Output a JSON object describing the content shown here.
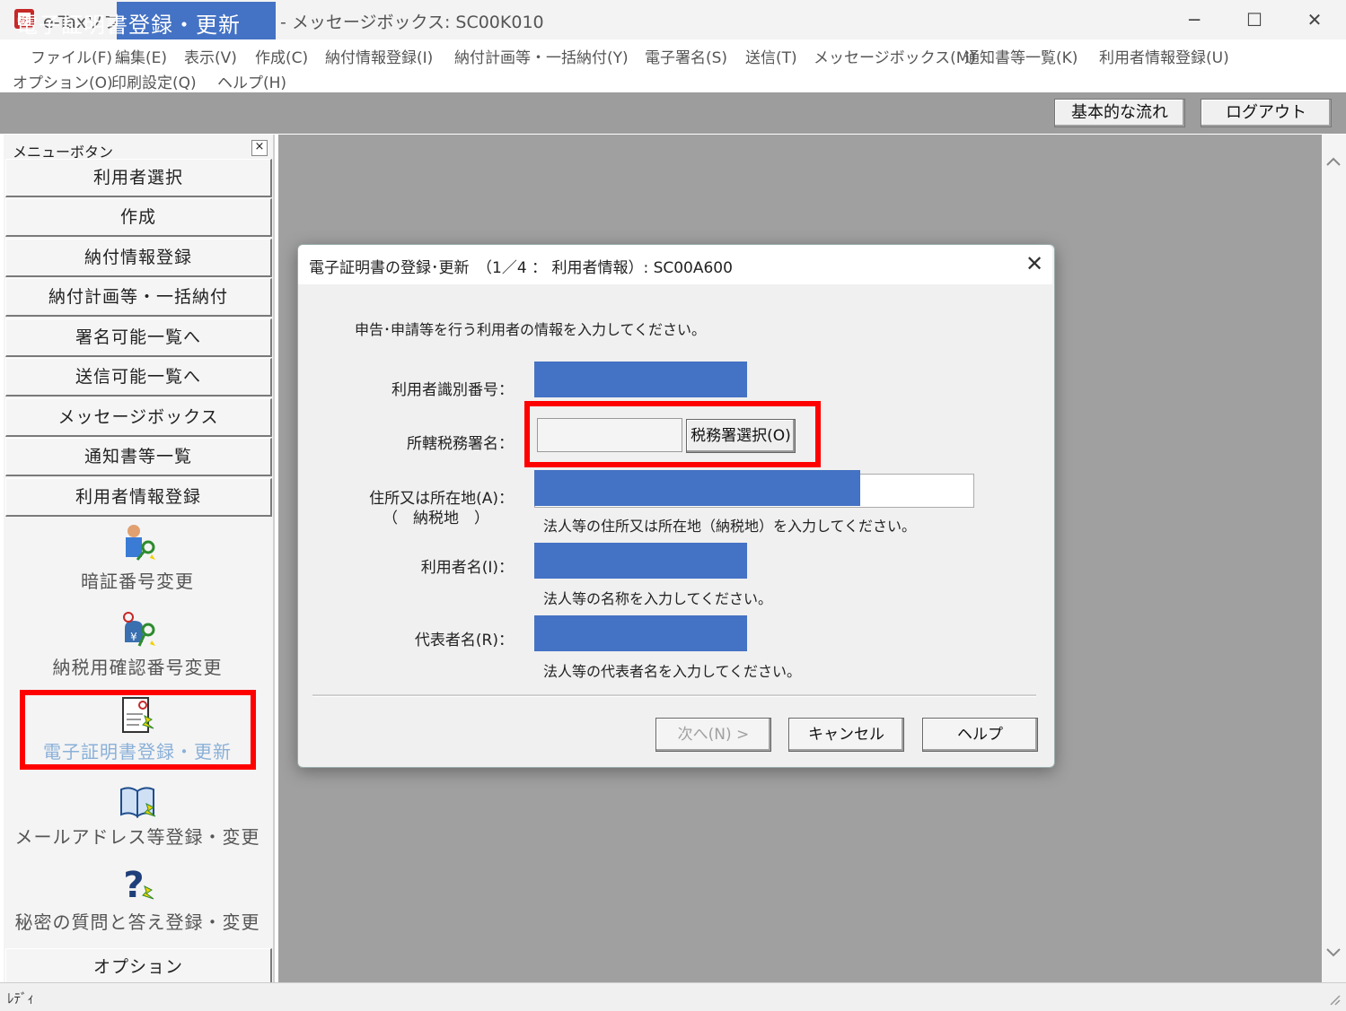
{
  "window": {
    "app_name": "e-Taxソフト",
    "title": "- メッセージボックス: SC00K010",
    "minimize": "─",
    "maximize": "☐",
    "close": "✕"
  },
  "menu": {
    "row1": [
      "ファイル(F)",
      "編集(E)",
      "表示(V)",
      "作成(C)",
      "納付情報登録(I)",
      "納付計画等・一括納付(Y)",
      "電子署名(S)",
      "送信(T)",
      "メッセージボックス(M)",
      "通知書等一覧(K)",
      "利用者情報登録(U)"
    ],
    "row2": [
      "オプション(O)",
      "印刷設定(Q)",
      "ヘルプ(H)"
    ]
  },
  "header": {
    "title": "電子証明書登録・更新",
    "basic_flow": "基本的な流れ",
    "logout": "ログアウト"
  },
  "sidebar": {
    "title": "メニューボタン",
    "close": "×",
    "buttons": [
      "利用者選択",
      "作成",
      "納付情報登録",
      "納付計画等・一括納付",
      "署名可能一覧へ",
      "送信可能一覧へ",
      "メッセージボックス",
      "通知書等一覧",
      "利用者情報登録"
    ],
    "icons": [
      {
        "label": "暗証番号変更",
        "icon": "person-key-icon"
      },
      {
        "label": "納税用確認番号変更",
        "icon": "money-bag-key-icon"
      },
      {
        "label": "電子証明書登録・更新",
        "icon": "certificate-icon"
      },
      {
        "label": "メールアドレス等登録・変更",
        "icon": "book-icon"
      },
      {
        "label": "秘密の質問と答え登録・変更",
        "icon": "question-icon"
      }
    ],
    "option": "オプション"
  },
  "status": {
    "text": "ﾚﾃﾞｨ"
  },
  "dialog": {
    "title": "電子証明書の登録･更新　（1／4 ： 利用者情報）: SC00A600",
    "close": "✕",
    "instruction": "申告･申請等を行う利用者の情報を入力してください。",
    "user_id_label": "利用者識別番号：",
    "tax_office_label": "所轄税務署名：",
    "tax_office_button": "税務署選択(O)",
    "address_label": "住所又は所在地(A)：",
    "address_sub": "（　納税地　）",
    "address_hint": "法人等の住所又は所在地（納税地）を入力してください。",
    "user_name_label": "利用者名(I)：",
    "user_name_hint": "法人等の名称を入力してください。",
    "rep_label": "代表者名(R)：",
    "rep_hint": "法人等の代表者名を入力してください。",
    "next": "次へ(N) >",
    "cancel": "キャンセル",
    "help": "ヘルプ"
  },
  "colors": {
    "redaction": "#4472c4",
    "highlight": "#ff0000",
    "header_bg": "#9d9d9d",
    "workspace_bg": "#a0a0a0"
  }
}
